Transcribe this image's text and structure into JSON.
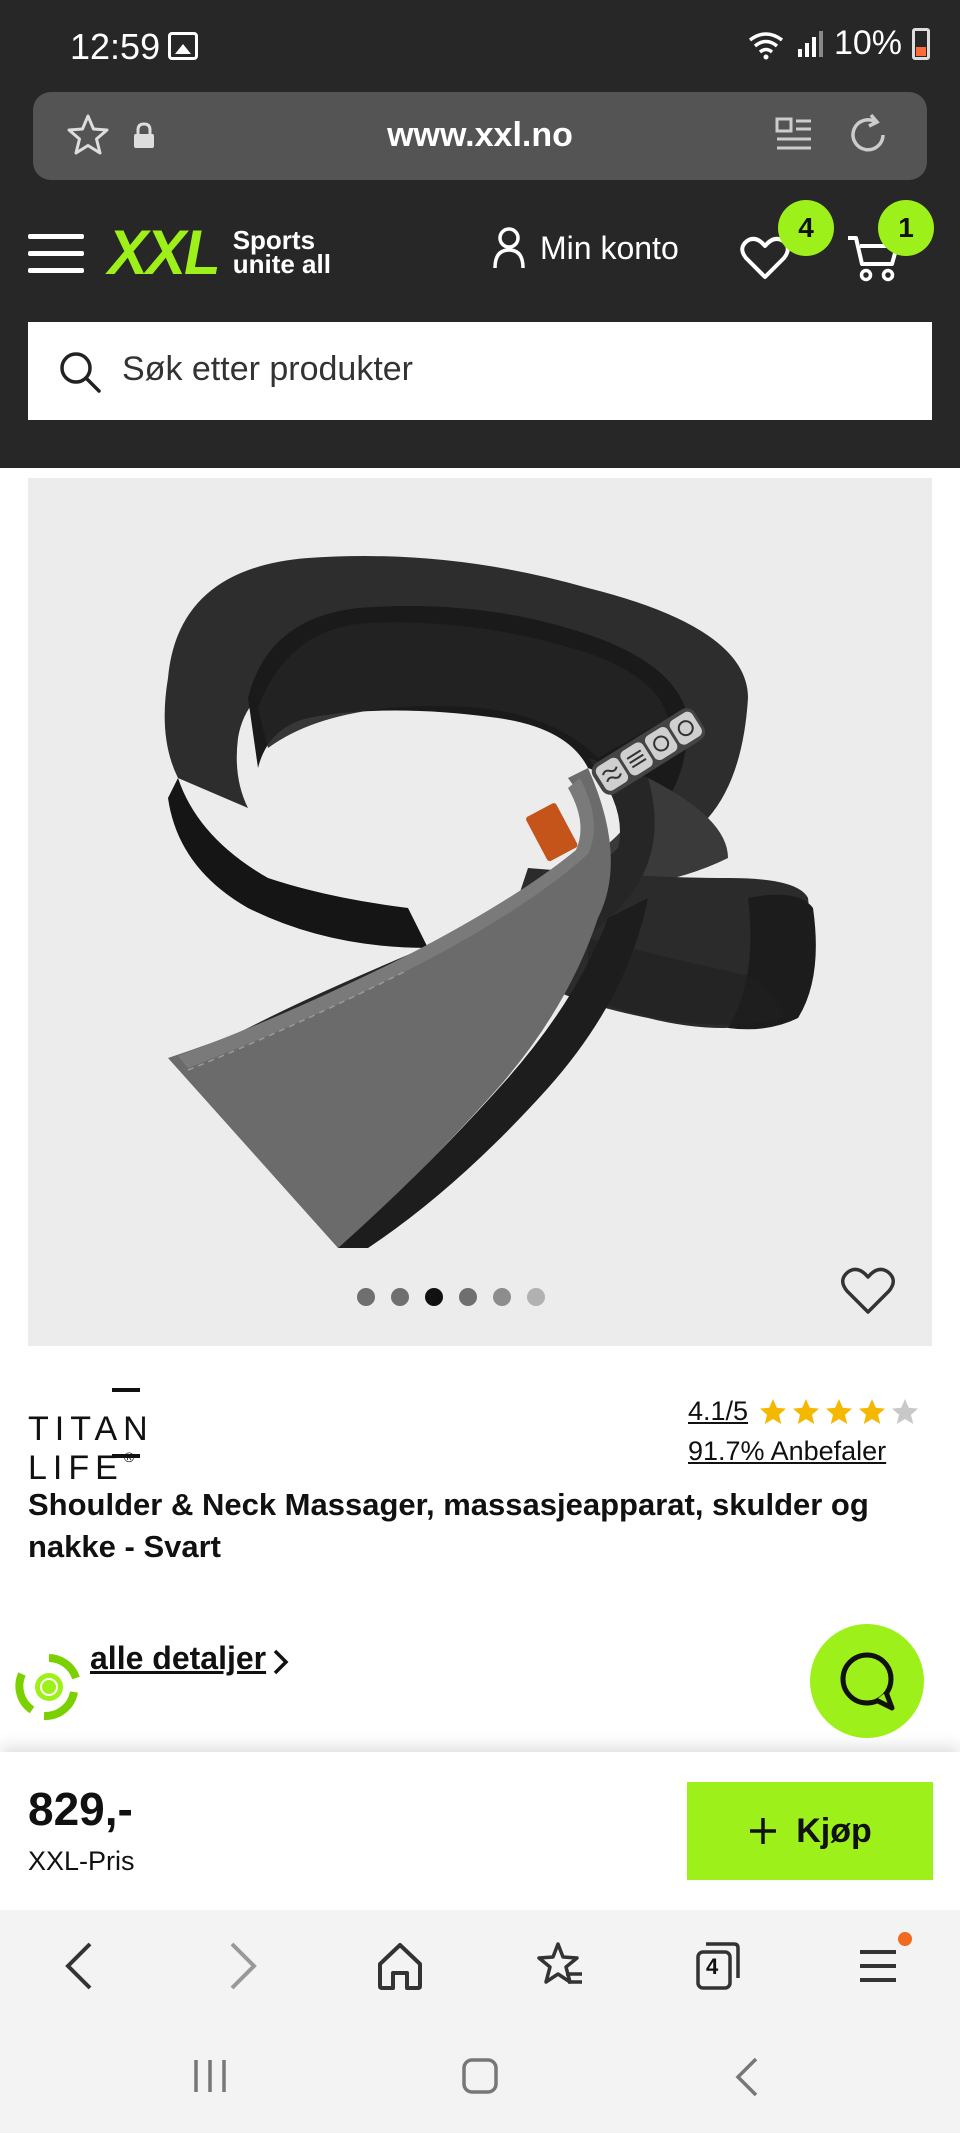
{
  "status_bar": {
    "time": "12:59",
    "battery": "10%"
  },
  "browser": {
    "url": "www.xxl.no"
  },
  "header": {
    "logo_main": "XXL",
    "logo_tag_line1": "Sports",
    "logo_tag_line2": "unite all",
    "account_label": "Min konto",
    "wishlist_count": "4",
    "cart_count": "1",
    "search_placeholder": "Søk etter produkter"
  },
  "gallery": {
    "image_count": 6,
    "active_index": 2
  },
  "product": {
    "brand": "TITAN LIFE",
    "brand_mark": "®",
    "rating": "4.1/5",
    "rating_value": 4.1,
    "rating_max": 5,
    "recommend": "91.7% Anbefaler",
    "title": "Shoulder & Neck Massager, massasjeapparat, skulder og nakke - Svart",
    "details_link": "alle detaljer"
  },
  "buy_bar": {
    "price": "829,-",
    "price_label": "XXL-Pris",
    "button_label": "Kjøp"
  },
  "colors": {
    "accent": "#9ef01a",
    "header_bg": "#272727",
    "star": "#f5b800"
  },
  "browser_nav": {
    "tabs_count": "4"
  }
}
